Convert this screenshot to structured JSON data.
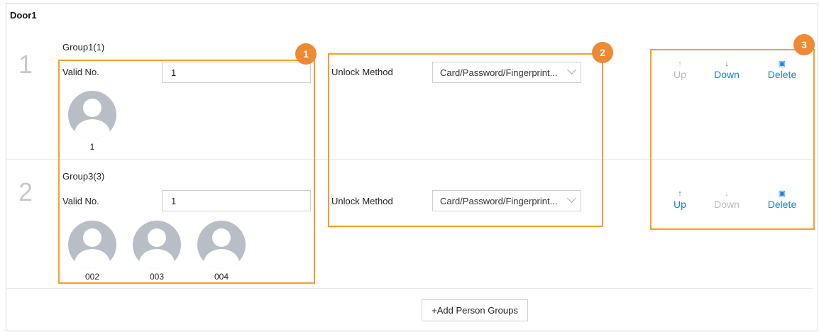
{
  "door": {
    "title": "Door1"
  },
  "groups": [
    {
      "number": "1",
      "name": "Group1(1)",
      "valid_label": "Valid No.",
      "valid_value": "1",
      "unlock_label": "Unlock Method",
      "unlock_value": "Card/Password/Fingerprint...",
      "members": [
        "1"
      ],
      "actions": {
        "up": "Up",
        "down": "Down",
        "delete": "Delete"
      },
      "actions_enabled": {
        "up": false,
        "down": true,
        "delete": true
      }
    },
    {
      "number": "2",
      "name": "Group3(3)",
      "valid_label": "Valid No.",
      "valid_value": "1",
      "unlock_label": "Unlock Method",
      "unlock_value": "Card/Password/Fingerprint...",
      "members": [
        "002",
        "003",
        "004"
      ],
      "actions": {
        "up": "Up",
        "down": "Down",
        "delete": "Delete"
      },
      "actions_enabled": {
        "up": true,
        "down": false,
        "delete": true
      }
    }
  ],
  "add_button": "+Add Person Groups",
  "callouts": [
    "1",
    "2",
    "3"
  ],
  "colors": {
    "accent": "#1a7fe3",
    "highlight": "#f0a030",
    "badge": "#ee8a33",
    "disabled": "#bbbbbb"
  },
  "icons": {
    "up": "arrow-up-icon",
    "down": "arrow-down-icon",
    "delete": "trash-icon",
    "avatar": "person-avatar-icon"
  }
}
